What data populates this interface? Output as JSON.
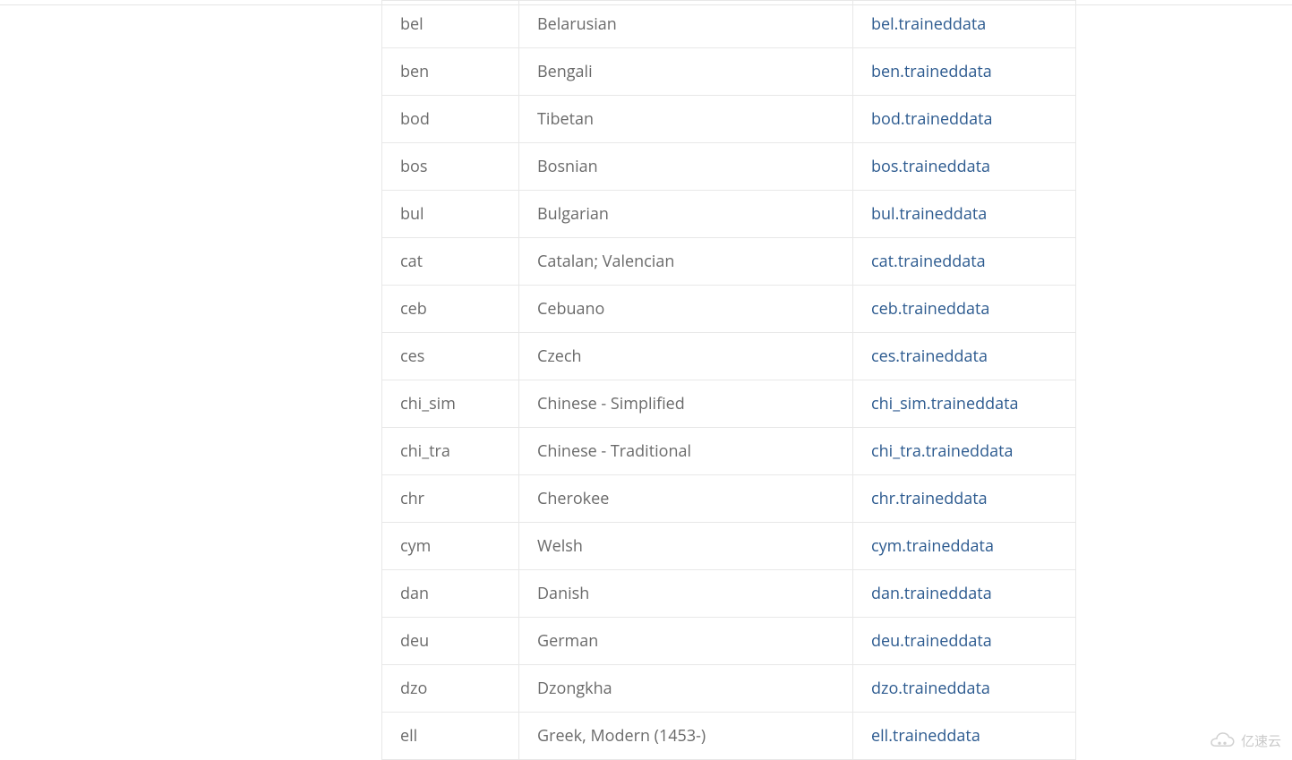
{
  "table": {
    "rows": [
      {
        "code": "bel",
        "language": "Belarusian",
        "file": "bel.traineddata"
      },
      {
        "code": "ben",
        "language": "Bengali",
        "file": "ben.traineddata"
      },
      {
        "code": "bod",
        "language": "Tibetan",
        "file": "bod.traineddata"
      },
      {
        "code": "bos",
        "language": "Bosnian",
        "file": "bos.traineddata"
      },
      {
        "code": "bul",
        "language": "Bulgarian",
        "file": "bul.traineddata"
      },
      {
        "code": "cat",
        "language": "Catalan; Valencian",
        "file": "cat.traineddata"
      },
      {
        "code": "ceb",
        "language": "Cebuano",
        "file": "ceb.traineddata"
      },
      {
        "code": "ces",
        "language": "Czech",
        "file": "ces.traineddata"
      },
      {
        "code": "chi_sim",
        "language": "Chinese - Simplified",
        "file": "chi_sim.traineddata"
      },
      {
        "code": "chi_tra",
        "language": "Chinese - Traditional",
        "file": "chi_tra.traineddata"
      },
      {
        "code": "chr",
        "language": "Cherokee",
        "file": "chr.traineddata"
      },
      {
        "code": "cym",
        "language": "Welsh",
        "file": "cym.traineddata"
      },
      {
        "code": "dan",
        "language": "Danish",
        "file": "dan.traineddata"
      },
      {
        "code": "deu",
        "language": "German",
        "file": "deu.traineddata"
      },
      {
        "code": "dzo",
        "language": "Dzongkha",
        "file": "dzo.traineddata"
      },
      {
        "code": "ell",
        "language": "Greek, Modern (1453-)",
        "file": "ell.traineddata"
      }
    ]
  },
  "watermark": {
    "text": "亿速云"
  }
}
